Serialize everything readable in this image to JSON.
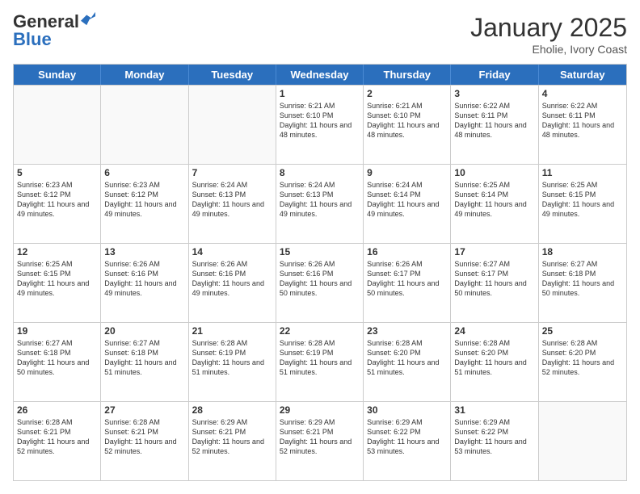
{
  "logo": {
    "text_general": "General",
    "text_blue": "Blue"
  },
  "header": {
    "month": "January 2025",
    "location": "Eholie, Ivory Coast"
  },
  "weekdays": [
    "Sunday",
    "Monday",
    "Tuesday",
    "Wednesday",
    "Thursday",
    "Friday",
    "Saturday"
  ],
  "weeks": [
    [
      {
        "day": "",
        "info": ""
      },
      {
        "day": "",
        "info": ""
      },
      {
        "day": "",
        "info": ""
      },
      {
        "day": "1",
        "info": "Sunrise: 6:21 AM\nSunset: 6:10 PM\nDaylight: 11 hours and 48 minutes."
      },
      {
        "day": "2",
        "info": "Sunrise: 6:21 AM\nSunset: 6:10 PM\nDaylight: 11 hours and 48 minutes."
      },
      {
        "day": "3",
        "info": "Sunrise: 6:22 AM\nSunset: 6:11 PM\nDaylight: 11 hours and 48 minutes."
      },
      {
        "day": "4",
        "info": "Sunrise: 6:22 AM\nSunset: 6:11 PM\nDaylight: 11 hours and 48 minutes."
      }
    ],
    [
      {
        "day": "5",
        "info": "Sunrise: 6:23 AM\nSunset: 6:12 PM\nDaylight: 11 hours and 49 minutes."
      },
      {
        "day": "6",
        "info": "Sunrise: 6:23 AM\nSunset: 6:12 PM\nDaylight: 11 hours and 49 minutes."
      },
      {
        "day": "7",
        "info": "Sunrise: 6:24 AM\nSunset: 6:13 PM\nDaylight: 11 hours and 49 minutes."
      },
      {
        "day": "8",
        "info": "Sunrise: 6:24 AM\nSunset: 6:13 PM\nDaylight: 11 hours and 49 minutes."
      },
      {
        "day": "9",
        "info": "Sunrise: 6:24 AM\nSunset: 6:14 PM\nDaylight: 11 hours and 49 minutes."
      },
      {
        "day": "10",
        "info": "Sunrise: 6:25 AM\nSunset: 6:14 PM\nDaylight: 11 hours and 49 minutes."
      },
      {
        "day": "11",
        "info": "Sunrise: 6:25 AM\nSunset: 6:15 PM\nDaylight: 11 hours and 49 minutes."
      }
    ],
    [
      {
        "day": "12",
        "info": "Sunrise: 6:25 AM\nSunset: 6:15 PM\nDaylight: 11 hours and 49 minutes."
      },
      {
        "day": "13",
        "info": "Sunrise: 6:26 AM\nSunset: 6:16 PM\nDaylight: 11 hours and 49 minutes."
      },
      {
        "day": "14",
        "info": "Sunrise: 6:26 AM\nSunset: 6:16 PM\nDaylight: 11 hours and 49 minutes."
      },
      {
        "day": "15",
        "info": "Sunrise: 6:26 AM\nSunset: 6:16 PM\nDaylight: 11 hours and 50 minutes."
      },
      {
        "day": "16",
        "info": "Sunrise: 6:26 AM\nSunset: 6:17 PM\nDaylight: 11 hours and 50 minutes."
      },
      {
        "day": "17",
        "info": "Sunrise: 6:27 AM\nSunset: 6:17 PM\nDaylight: 11 hours and 50 minutes."
      },
      {
        "day": "18",
        "info": "Sunrise: 6:27 AM\nSunset: 6:18 PM\nDaylight: 11 hours and 50 minutes."
      }
    ],
    [
      {
        "day": "19",
        "info": "Sunrise: 6:27 AM\nSunset: 6:18 PM\nDaylight: 11 hours and 50 minutes."
      },
      {
        "day": "20",
        "info": "Sunrise: 6:27 AM\nSunset: 6:18 PM\nDaylight: 11 hours and 51 minutes."
      },
      {
        "day": "21",
        "info": "Sunrise: 6:28 AM\nSunset: 6:19 PM\nDaylight: 11 hours and 51 minutes."
      },
      {
        "day": "22",
        "info": "Sunrise: 6:28 AM\nSunset: 6:19 PM\nDaylight: 11 hours and 51 minutes."
      },
      {
        "day": "23",
        "info": "Sunrise: 6:28 AM\nSunset: 6:20 PM\nDaylight: 11 hours and 51 minutes."
      },
      {
        "day": "24",
        "info": "Sunrise: 6:28 AM\nSunset: 6:20 PM\nDaylight: 11 hours and 51 minutes."
      },
      {
        "day": "25",
        "info": "Sunrise: 6:28 AM\nSunset: 6:20 PM\nDaylight: 11 hours and 52 minutes."
      }
    ],
    [
      {
        "day": "26",
        "info": "Sunrise: 6:28 AM\nSunset: 6:21 PM\nDaylight: 11 hours and 52 minutes."
      },
      {
        "day": "27",
        "info": "Sunrise: 6:28 AM\nSunset: 6:21 PM\nDaylight: 11 hours and 52 minutes."
      },
      {
        "day": "28",
        "info": "Sunrise: 6:29 AM\nSunset: 6:21 PM\nDaylight: 11 hours and 52 minutes."
      },
      {
        "day": "29",
        "info": "Sunrise: 6:29 AM\nSunset: 6:21 PM\nDaylight: 11 hours and 52 minutes."
      },
      {
        "day": "30",
        "info": "Sunrise: 6:29 AM\nSunset: 6:22 PM\nDaylight: 11 hours and 53 minutes."
      },
      {
        "day": "31",
        "info": "Sunrise: 6:29 AM\nSunset: 6:22 PM\nDaylight: 11 hours and 53 minutes."
      },
      {
        "day": "",
        "info": ""
      }
    ]
  ]
}
